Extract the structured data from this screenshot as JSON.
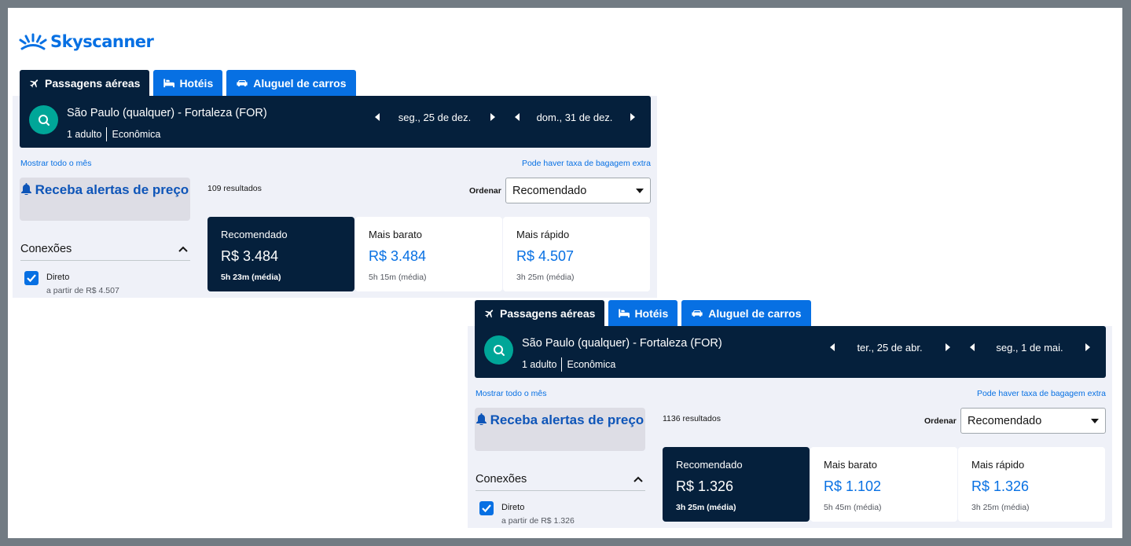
{
  "brand": {
    "name": "Skyscanner",
    "color": "#0770e3"
  },
  "colors": {
    "navy": "#05203c",
    "blue": "#0770e3",
    "teal": "#00a698",
    "panel": "#eff1f8"
  },
  "panels": [
    {
      "tabs": [
        {
          "label": "Passagens aéreas",
          "icon": "plane-icon",
          "active": true
        },
        {
          "label": "Hotéis",
          "icon": "bed-icon",
          "active": false
        },
        {
          "label": "Aluguel de carros",
          "icon": "car-icon",
          "active": false
        }
      ],
      "search": {
        "route": "São Paulo (qualquer) - Fortaleza (FOR)",
        "passengers": "1 adulto",
        "cabin": "Econômica",
        "depart": "seg., 25 de dez.",
        "return": "dom., 31 de dez."
      },
      "show_month": "Mostrar todo o mês",
      "baggage_note": "Pode haver taxa de bagagem extra",
      "price_alert": "Receba alertas de preço",
      "connections": "Conexões",
      "direct_label": "Direto",
      "direct_price": "a partir de R$ 4.507",
      "results": "109 resultados",
      "sort_label": "Ordenar",
      "sort_value": "Recomendado",
      "cards": [
        {
          "title": "Recomendado",
          "price": "R$ 3.484",
          "duration": "5h 23m (média)",
          "active": true
        },
        {
          "title": "Mais barato",
          "price": "R$ 3.484",
          "duration": "5h 15m (média)",
          "active": false
        },
        {
          "title": "Mais rápido",
          "price": "R$ 4.507",
          "duration": "3h 25m (média)",
          "active": false
        }
      ]
    },
    {
      "tabs": [
        {
          "label": "Passagens aéreas",
          "icon": "plane-icon",
          "active": true
        },
        {
          "label": "Hotéis",
          "icon": "bed-icon",
          "active": false
        },
        {
          "label": "Aluguel de carros",
          "icon": "car-icon",
          "active": false
        }
      ],
      "search": {
        "route": "São Paulo (qualquer) - Fortaleza (FOR)",
        "passengers": "1 adulto",
        "cabin": "Econômica",
        "depart": "ter., 25 de abr.",
        "return": "seg., 1 de mai."
      },
      "show_month": "Mostrar todo o mês",
      "baggage_note": "Pode haver taxa de bagagem extra",
      "price_alert": "Receba alertas de preço",
      "connections": "Conexões",
      "direct_label": "Direto",
      "direct_price": "a partir de R$ 1.326",
      "results": "1136 resultados",
      "sort_label": "Ordenar",
      "sort_value": "Recomendado",
      "cards": [
        {
          "title": "Recomendado",
          "price": "R$ 1.326",
          "duration": "3h 25m (média)",
          "active": true
        },
        {
          "title": "Mais barato",
          "price": "R$ 1.102",
          "duration": "5h 45m (média)",
          "active": false
        },
        {
          "title": "Mais rápido",
          "price": "R$ 1.326",
          "duration": "3h 25m (média)",
          "active": false
        }
      ]
    }
  ]
}
